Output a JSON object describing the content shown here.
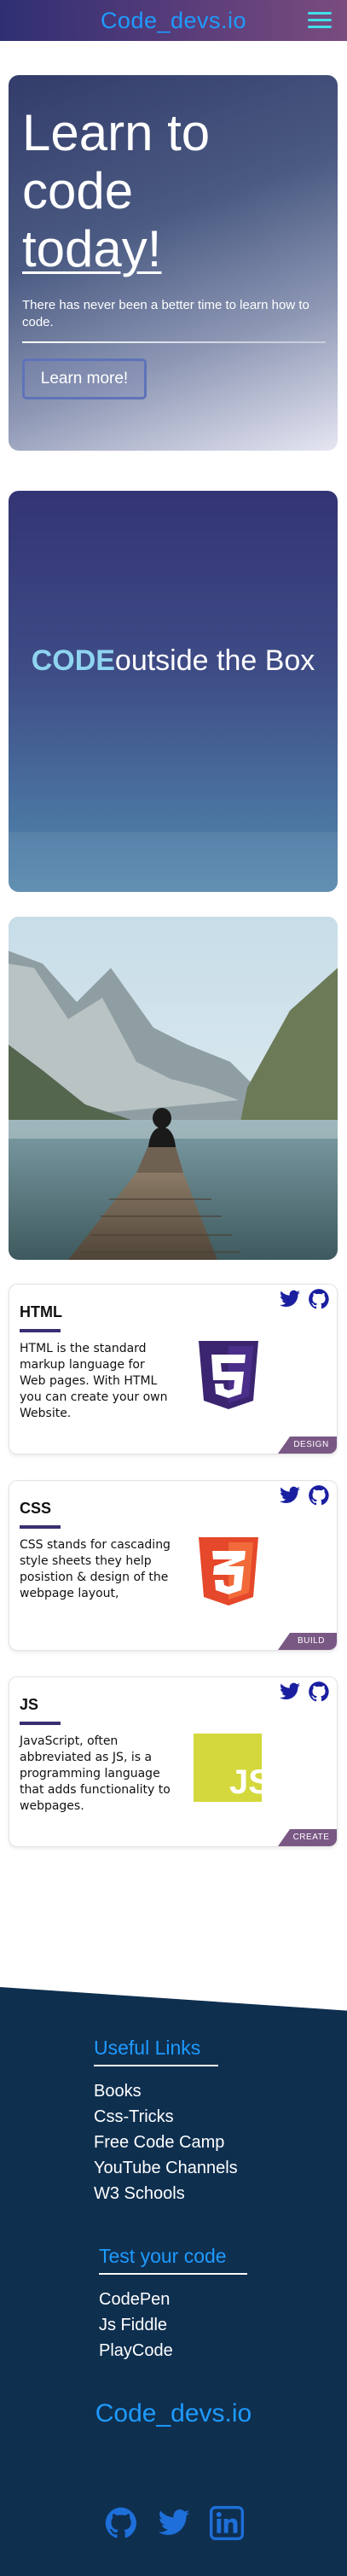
{
  "header": {
    "brand": "Code_devs.io"
  },
  "hero": {
    "title_line1": "Learn to",
    "title_line2": "code",
    "title_line3": "today!",
    "subtitle": "There has never been a better time to learn how to code.",
    "button_label": "Learn more!"
  },
  "banner": {
    "highlight": "CODE",
    "rest": "outside the Box"
  },
  "cards": [
    {
      "title": "HTML",
      "text": "HTML is the standard markup language for Web pages. With HTML you can create your own Website.",
      "badge": "DESIGN",
      "logo": "html5-logo"
    },
    {
      "title": "CSS",
      "text": "CSS stands for cascading style sheets they help posistion & design of the webpage layout,",
      "badge": "BUILD",
      "logo": "css3-logo"
    },
    {
      "title": "JS",
      "text": "JavaScript, often abbreviated as JS, is a programming language that adds functionality to webpages.",
      "badge": "CREATE",
      "logo": "js-logo"
    }
  ],
  "footer": {
    "useful_title": "Useful Links",
    "useful_links": [
      "Books",
      "Css-Tricks",
      "Free Code Camp",
      "YouTube Channels",
      "W3 Schools"
    ],
    "test_title": "Test your code",
    "test_links": [
      "CodePen",
      "Js Fiddle",
      "PlayCode"
    ],
    "brand": "Code_devs.io"
  },
  "colors": {
    "accent_blue": "#1e9bff",
    "hamburger": "#41e0e8",
    "footer_bg": "#0f2f4f",
    "social_icon": "#1a1fa0",
    "badge": "#7a5884"
  }
}
